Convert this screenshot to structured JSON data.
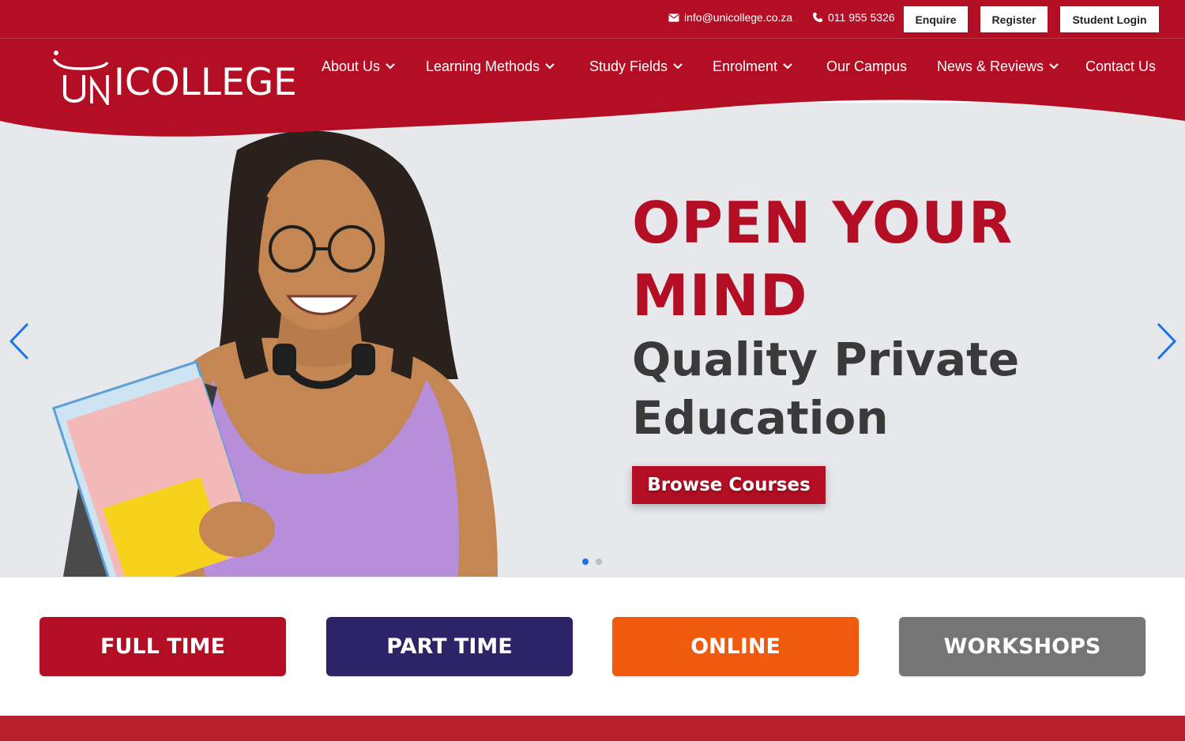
{
  "topbar": {
    "email": "info@unicollege.co.za",
    "phone": "011 955 5326",
    "enquire_label": "Enquire",
    "register_label": "Register",
    "login_label": "Student Login"
  },
  "logo": {
    "text": "UNICOLLEGE"
  },
  "nav": {
    "items": [
      {
        "label": "About Us",
        "has_dropdown": true
      },
      {
        "label": "Learning Methods",
        "has_dropdown": true
      },
      {
        "label": "Study Fields",
        "has_dropdown": true
      },
      {
        "label": "Enrolment",
        "has_dropdown": true
      },
      {
        "label": "Our Campus",
        "has_dropdown": false
      },
      {
        "label": "News & Reviews",
        "has_dropdown": true
      },
      {
        "label": "Contact Us",
        "has_dropdown": false
      }
    ]
  },
  "hero": {
    "headline_line1": "OPEN YOUR",
    "headline_line2": "MIND",
    "subhead_line1": "Quality Private",
    "subhead_line2": "Education",
    "cta_label": "Browse Courses",
    "slide_count": 2,
    "active_slide": 1
  },
  "modes": {
    "full_time": "FULL TIME",
    "part_time": "PART TIME",
    "online": "ONLINE",
    "workshops": "WORKSHOPS"
  },
  "colors": {
    "brand_red": "#b30e24",
    "part_time": "#2d2369",
    "online": "#f05a0c",
    "workshops": "#757575",
    "slider_arrow": "#1a73e8"
  }
}
